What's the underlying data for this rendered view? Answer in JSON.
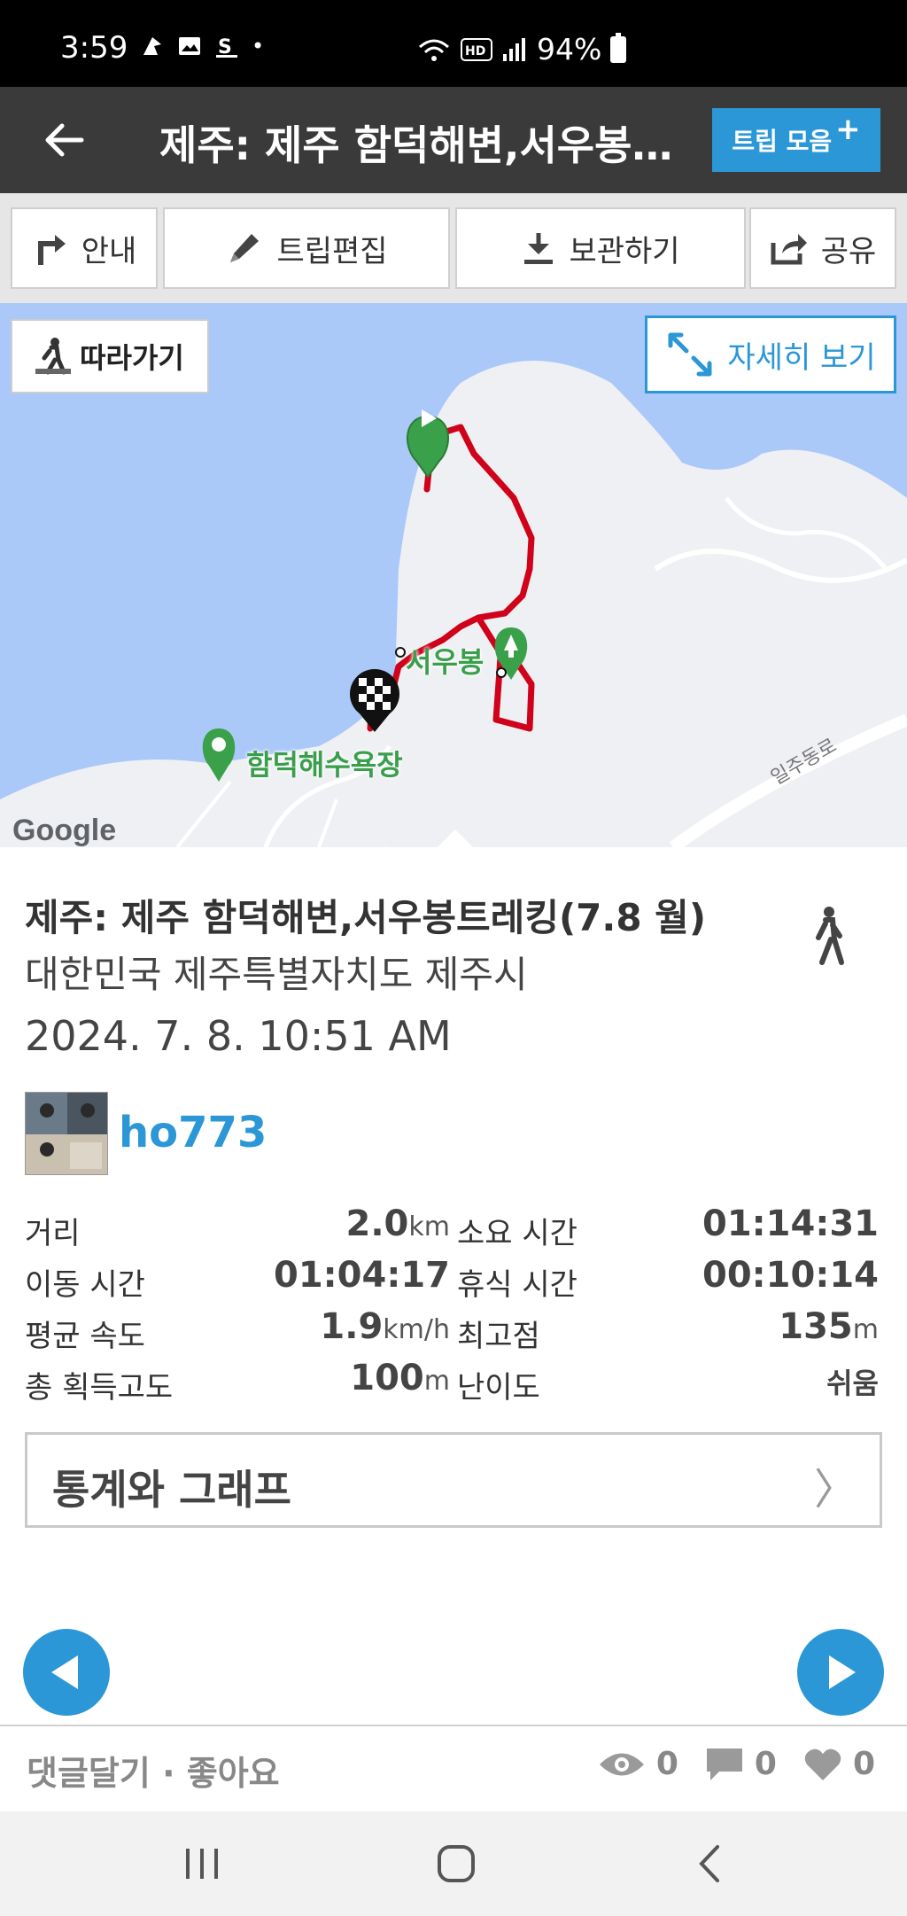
{
  "status_bar": {
    "time": "3:59",
    "dot": "•",
    "battery": "94%"
  },
  "header": {
    "title": "제주: 제주 함덕해변,서우봉…",
    "trip_collection_label": "트립 모음",
    "plus": "+"
  },
  "toolbar": {
    "guide_label": "안내",
    "edit_label": "트립편집",
    "save_label": "보관하기",
    "share_label": "공유"
  },
  "map": {
    "follow_label": "따라가기",
    "detail_label": "자세히 보기",
    "poi_seoubong": "서우봉",
    "poi_hamdeok": "함덕해수욕장",
    "road_label": "일주동로",
    "google": "Google"
  },
  "trip": {
    "name": "제주: 제주 함덕해변,서우봉트레킹(7.8 월)",
    "location": "대한민국 제주특별자치도 제주시",
    "datetime": "2024. 7. 8. 10:51 AM",
    "user": "ho773"
  },
  "stats": {
    "distance_label": "거리",
    "distance_value": "2.0",
    "distance_unit": "km",
    "duration_label": "소요 시간",
    "duration_value": "01:14:31",
    "moving_label": "이동 시간",
    "moving_value": "01:04:17",
    "rest_label": "휴식 시간",
    "rest_value": "00:10:14",
    "avg_speed_label": "평균 속도",
    "avg_speed_value": "1.9",
    "avg_speed_unit": "km/h",
    "max_alt_label": "최고점",
    "max_alt_value": "135",
    "max_alt_unit": "m",
    "gain_label": "총 획득고도",
    "gain_value": "100",
    "gain_unit": "m",
    "difficulty_label": "난이도",
    "difficulty_value": "쉬움"
  },
  "graph_link": {
    "label": "통계와 그래프",
    "chevron": "〉"
  },
  "footer": {
    "comment_like": "댓글달기 · 좋아요",
    "views": "0",
    "comments": "0",
    "likes": "0"
  },
  "colors": {
    "accent": "#2b97d6",
    "track": "#d0021b",
    "sea": "#aac8f8",
    "land": "#eef0f3"
  }
}
